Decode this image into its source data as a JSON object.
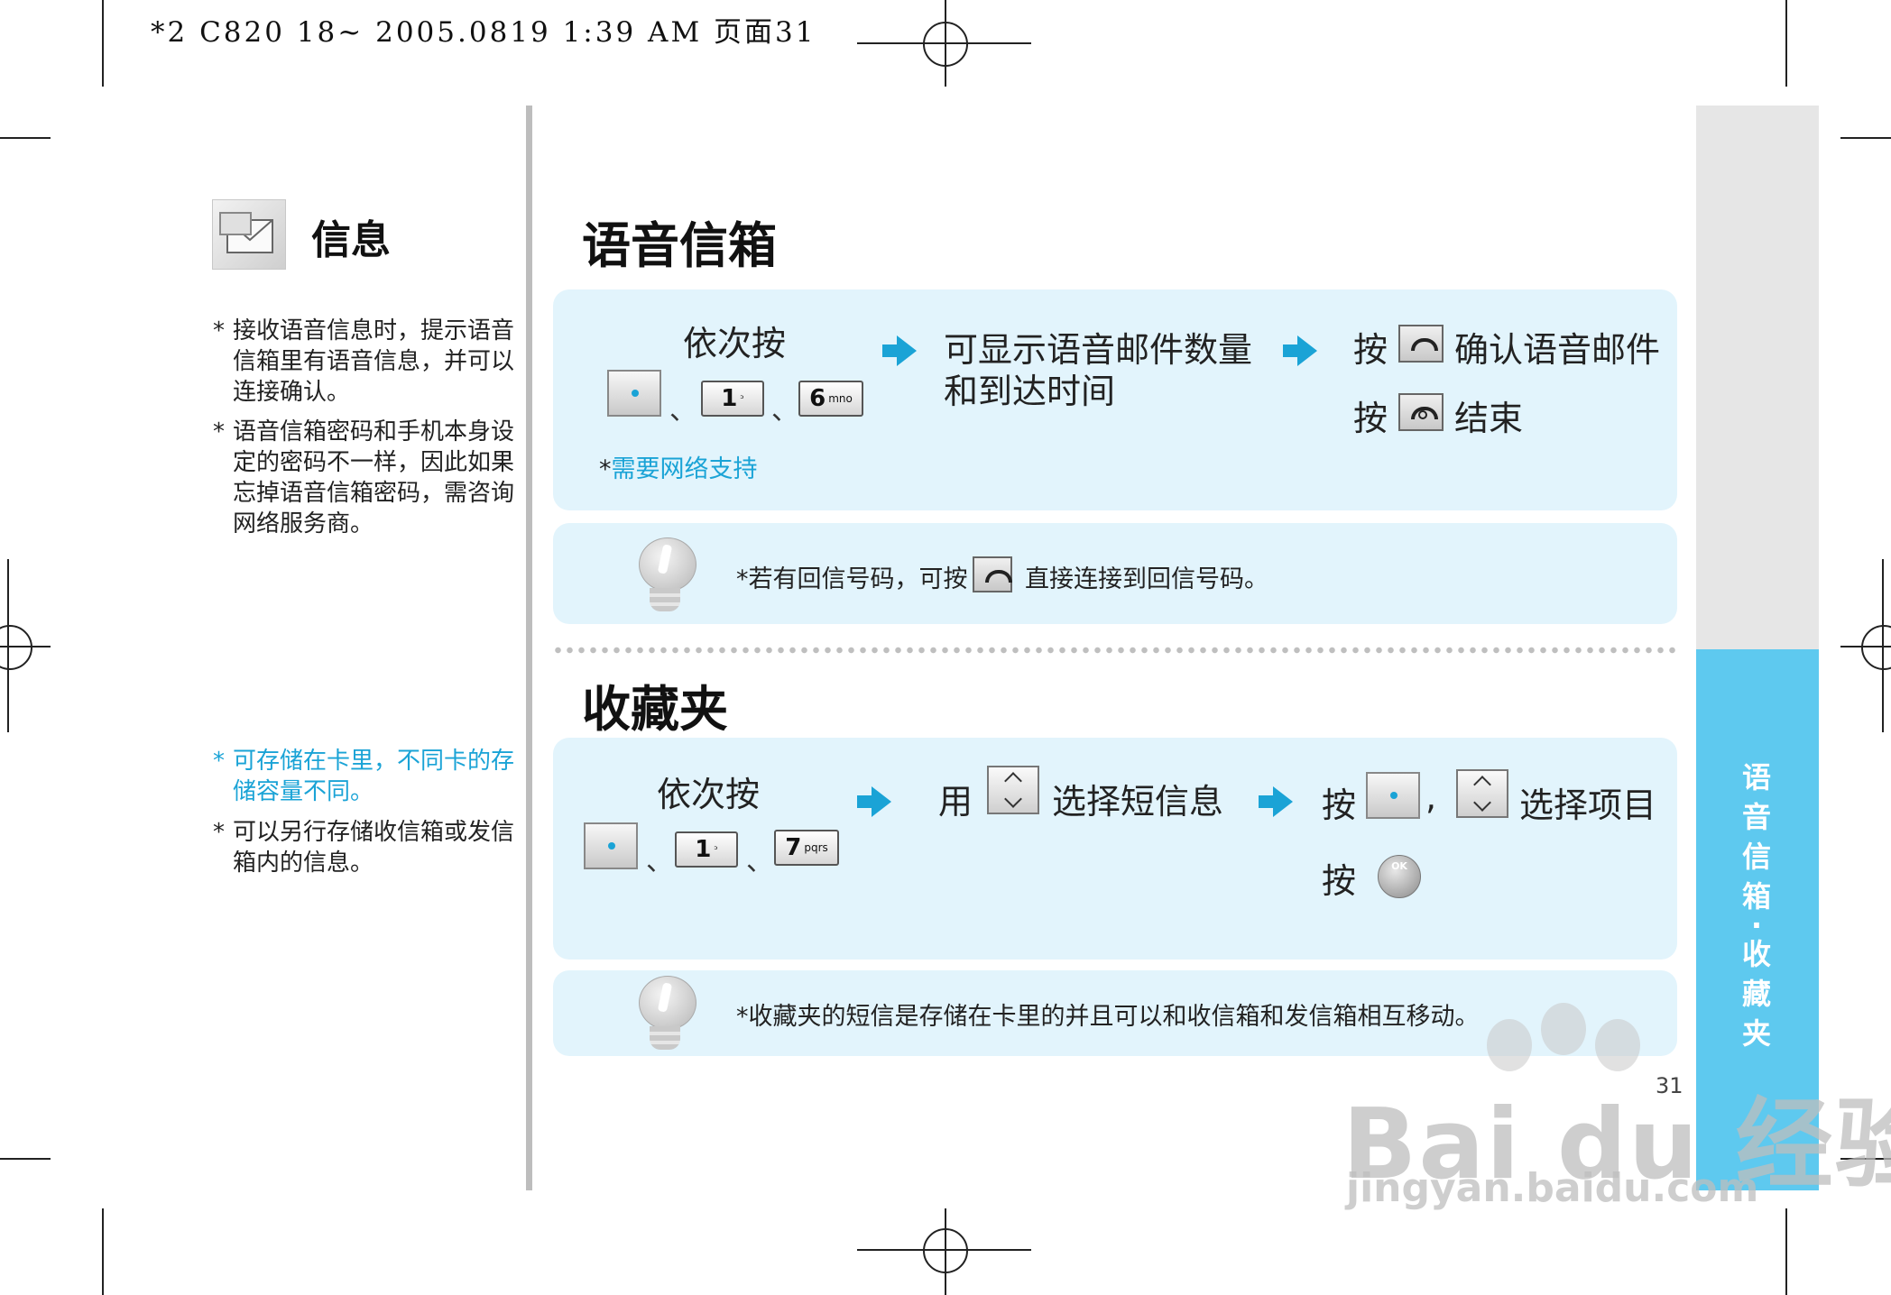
{
  "print_header": "*2 C820 18~ 2005.0819 1:39 AM 页面31",
  "left": {
    "title": "信息",
    "notes_top": [
      "接收语音信息时，提示语音信箱里有语音信息，并可以连接确认。",
      "语音信箱密码和手机本身设定的密码不一样，因此如果忘掉语音信箱密码，需咨询网络服务商。"
    ],
    "notes_bottom": [
      {
        "text": "可存储在卡里，不同卡的存储容量不同。",
        "color": "#1aa3d6"
      },
      {
        "text": "可以另行存储收信箱或发信箱内的信息。",
        "color": "#222222"
      }
    ],
    "star": "*"
  },
  "voicemail": {
    "title": "语音信箱",
    "step1_label": "依次按",
    "keys": [
      {
        "num": "1",
        "sub": "ᵓ"
      },
      {
        "num": "6",
        "sub": "mno"
      }
    ],
    "separator": "、",
    "step2_line1": "可显示语音邮件数量",
    "step2_line2": "和到达时间",
    "step3_press": "按",
    "step3_confirm": "确认语音邮件",
    "step3_end": "结束",
    "network_note": "需要网络支持",
    "tip_before": "若有回信号码，可按",
    "tip_after": "直接连接到回信号码。"
  },
  "favorites": {
    "title": "收藏夹",
    "step1_label": "依次按",
    "keys": [
      {
        "num": "1",
        "sub": "ᵓ"
      },
      {
        "num": "7",
        "sub": "pqrs"
      }
    ],
    "separator": "、",
    "step2_use": "用",
    "step2_select": "选择短信息",
    "step3_press": "按",
    "step3_comma": ",",
    "step3_select": "选择项目",
    "ok_label": "OK",
    "tip": "收藏夹的短信是存储在卡里的并且可以和收信箱和发信箱相互移动。"
  },
  "sidebar": {
    "tab_label": [
      "语",
      "音",
      "信",
      "箱",
      "·",
      "收",
      "藏",
      "夹"
    ],
    "gray": "#e6e6e6",
    "blue": "#5ec9ef"
  },
  "page_number": "31",
  "watermark": {
    "main": "Bai du 经验",
    "sub": "jingyan.baidu.com"
  },
  "colors": {
    "accent": "#1aa3d6",
    "panel": "#e2f4fc"
  }
}
